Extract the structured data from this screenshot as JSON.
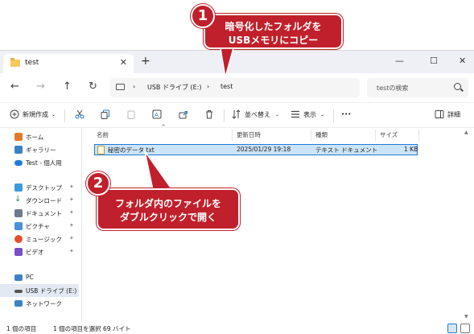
{
  "window": {
    "tab_title": "test",
    "tab_close": "✕",
    "new_tab": "+",
    "minimize": "—",
    "maximize": "☐",
    "close": "✕"
  },
  "nav": {
    "back": "←",
    "forward": "→",
    "up": "↑",
    "refresh": "↻",
    "breadcrumb": [
      "USB ドライブ (E:)",
      "test"
    ],
    "chevron": "›",
    "search_placeholder": "testの検索"
  },
  "commands": {
    "new": "新規作成",
    "sort": "並べ替え",
    "view": "表示",
    "more": "•••",
    "details": "詳細"
  },
  "sidebar": {
    "items": [
      {
        "label": "ホーム",
        "icon": "home-icon",
        "color": "#e07a2e"
      },
      {
        "label": "ギャラリー",
        "icon": "gallery-icon",
        "color": "#3b82c4"
      },
      {
        "label": "Test - 個人用",
        "icon": "cloud-icon",
        "color": "#1e7bd6"
      },
      {
        "label": "デスクトップ",
        "icon": "desktop-icon",
        "color": "#3a9bd8",
        "pinned": true
      },
      {
        "label": "ダウンロード",
        "icon": "download-icon",
        "color": "#2e8b57",
        "pinned": true
      },
      {
        "label": "ドキュメント",
        "icon": "documents-icon",
        "color": "#6b7b8c",
        "pinned": true
      },
      {
        "label": "ピクチャ",
        "icon": "pictures-icon",
        "color": "#4a90d9",
        "pinned": true
      },
      {
        "label": "ミュージック",
        "icon": "music-icon",
        "color": "#e0522e",
        "pinned": true
      },
      {
        "label": "ビデオ",
        "icon": "videos-icon",
        "color": "#7a4fc4",
        "pinned": true
      },
      {
        "label": "PC",
        "icon": "pc-icon",
        "color": "#3b82c4"
      },
      {
        "label": "USB ドライブ (E:)",
        "icon": "usb-drive-icon",
        "color": "#555555",
        "selected": true
      },
      {
        "label": "ネットワーク",
        "icon": "network-icon",
        "color": "#3b82c4"
      }
    ],
    "pin_glyph": "📌"
  },
  "columns": {
    "name": "名前",
    "modified": "更新日時",
    "type": "種類",
    "size": "サイズ",
    "sort_glyph": "^"
  },
  "files": [
    {
      "name": "秘密のデータ.txt",
      "modified": "2025/01/29 19:18",
      "type": "テキスト ドキュメント",
      "size": "1 KB"
    }
  ],
  "status": {
    "count": "1 個の項目",
    "selection": "1 個の項目を選択  69 バイト"
  },
  "callouts": {
    "c1_number": "1",
    "c1_line1": "暗号化したフォルダを",
    "c1_line2": "USBメモリにコピー",
    "c2_number": "2",
    "c2_line1": "フォルダ内のファイルを",
    "c2_line2": "ダブルクリックで開く"
  },
  "colors": {
    "callout_red": "#c0202b",
    "selection_blue": "#cce4f7",
    "accent_blue": "#1e7bd6"
  }
}
